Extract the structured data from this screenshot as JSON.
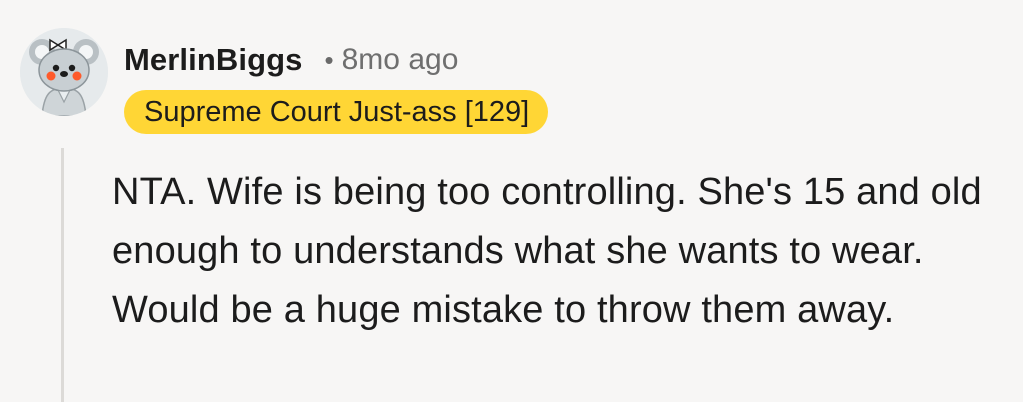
{
  "comment": {
    "author": "MerlinBiggs",
    "separator": "•",
    "timestamp": "8mo ago",
    "flair": "Supreme Court Just-ass [129]",
    "avatar_icon": "snoo-avatar-icon",
    "body": "NTA. Wife is being too controlling. She's 15 and old enough to understands what she wants to wear. Would be a huge mistake to throw them away."
  },
  "colors": {
    "background": "#f7f6f5",
    "flair_background": "#ffd635",
    "thread_line": "#dcdad7",
    "text": "#1c1c1c",
    "muted_text": "#6f6f6f"
  }
}
